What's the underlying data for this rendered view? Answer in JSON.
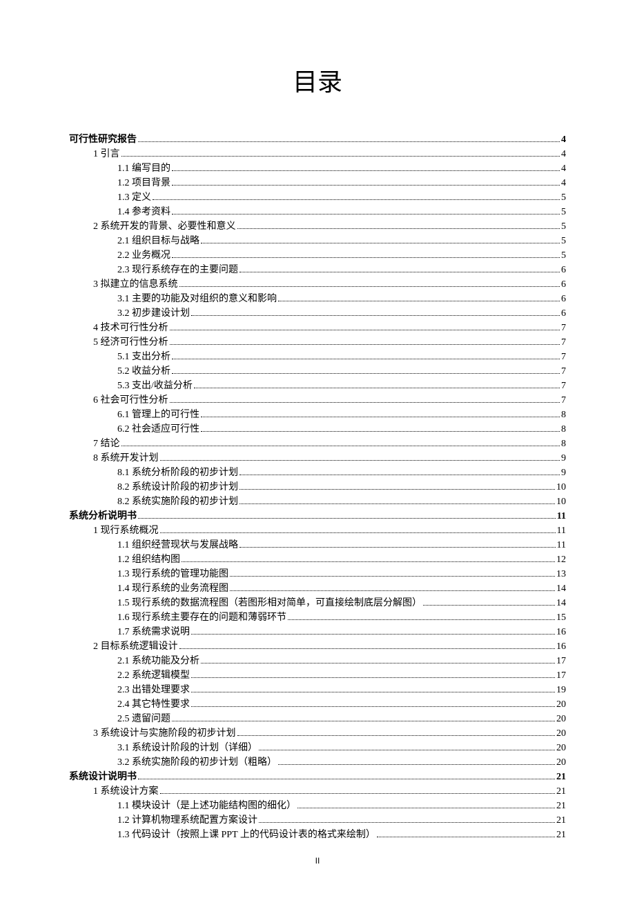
{
  "title": "目录",
  "page_footer": "II",
  "toc": [
    {
      "level": 0,
      "label": "可行性研究报告",
      "page": "4"
    },
    {
      "level": 1,
      "label": "1 引言",
      "page": "4"
    },
    {
      "level": 2,
      "label": "1.1 编写目的",
      "page": "4"
    },
    {
      "level": 2,
      "label": "1.2 项目背景",
      "page": "4"
    },
    {
      "level": 2,
      "label": "1.3 定义",
      "page": "5"
    },
    {
      "level": 2,
      "label": "1.4 参考资料",
      "page": "5"
    },
    {
      "level": 1,
      "label": "2 系统开发的背景、必要性和意义",
      "page": "5"
    },
    {
      "level": 2,
      "label": "2.1 组织目标与战略",
      "page": "5"
    },
    {
      "level": 2,
      "label": "2.2 业务概况",
      "page": "5"
    },
    {
      "level": 2,
      "label": "2.3 现行系统存在的主要问题",
      "page": "6"
    },
    {
      "level": 1,
      "label": "3 拟建立的信息系统",
      "page": "6"
    },
    {
      "level": 2,
      "label": "3.1 主要的功能及对组织的意义和影响",
      "page": "6"
    },
    {
      "level": 2,
      "label": "3.2 初步建设计划",
      "page": "6"
    },
    {
      "level": 1,
      "label": "4 技术可行性分析",
      "page": "7"
    },
    {
      "level": 1,
      "label": "5 经济可行性分析",
      "page": "7"
    },
    {
      "level": 2,
      "label": "5.1 支出分析",
      "page": "7"
    },
    {
      "level": 2,
      "label": "5.2 收益分析",
      "page": "7"
    },
    {
      "level": 2,
      "label": "5.3 支出/收益分析",
      "page": "7"
    },
    {
      "level": 1,
      "label": "6 社会可行性分析",
      "page": "7"
    },
    {
      "level": 2,
      "label": "6.1 管理上的可行性",
      "page": "8"
    },
    {
      "level": 2,
      "label": "6.2 社会适应可行性",
      "page": "8"
    },
    {
      "level": 1,
      "label": "7 结论",
      "page": "8"
    },
    {
      "level": 1,
      "label": "8 系统开发计划",
      "page": "9"
    },
    {
      "level": 2,
      "label": "8.1 系统分析阶段的初步计划",
      "page": "9"
    },
    {
      "level": 2,
      "label": "8.2 系统设计阶段的初步计划",
      "page": "10"
    },
    {
      "level": 2,
      "label": "8.2 系统实施阶段的初步计划",
      "page": "10"
    },
    {
      "level": 0,
      "label": "系统分析说明书",
      "page": "11"
    },
    {
      "level": 1,
      "label": "1 现行系统概况",
      "page": "11"
    },
    {
      "level": 2,
      "label": "1.1 组织经营现状与发展战略",
      "page": "11"
    },
    {
      "level": 2,
      "label": "1.2 组织结构图",
      "page": "12"
    },
    {
      "level": 2,
      "label": "1.3 现行系统的管理功能图",
      "page": "13"
    },
    {
      "level": 2,
      "label": "1.4 现行系统的业务流程图",
      "page": "14"
    },
    {
      "level": 2,
      "label": "1.5 现行系统的数据流程图（若图形相对简单，可直接绘制底层分解图）",
      "page": "14"
    },
    {
      "level": 2,
      "label": "1.6 现行系统主要存在的问题和薄弱环节",
      "page": "15"
    },
    {
      "level": 2,
      "label": "1.7 系统需求说明",
      "page": "16"
    },
    {
      "level": 1,
      "label": "2 目标系统逻辑设计",
      "page": "16"
    },
    {
      "level": 2,
      "label": "2.1 系统功能及分析",
      "page": "17"
    },
    {
      "level": 2,
      "label": "2.2 系统逻辑模型",
      "page": "17"
    },
    {
      "level": 2,
      "label": "2.3 出错处理要求",
      "page": "19"
    },
    {
      "level": 2,
      "label": "2.4 其它特性要求",
      "page": "20"
    },
    {
      "level": 2,
      "label": "2.5 遗留问题",
      "page": "20"
    },
    {
      "level": 1,
      "label": "3 系统设计与实施阶段的初步计划",
      "page": "20"
    },
    {
      "level": 2,
      "label": "3.1 系统设计阶段的计划（详细）",
      "page": "20"
    },
    {
      "level": 2,
      "label": "3.2 系统实施阶段的初步计划（粗略）",
      "page": "20"
    },
    {
      "level": 0,
      "label": "系统设计说明书",
      "page": "21"
    },
    {
      "level": 1,
      "label": "1 系统设计方案",
      "page": "21"
    },
    {
      "level": 2,
      "label": "1.1 模块设计（是上述功能结构图的细化）",
      "page": "21"
    },
    {
      "level": 2,
      "label": "1.2 计算机物理系统配置方案设计",
      "page": "21"
    },
    {
      "level": 2,
      "label": "1.3 代码设计（按照上课 PPT 上的代码设计表的格式来绘制）",
      "page": "21"
    }
  ]
}
